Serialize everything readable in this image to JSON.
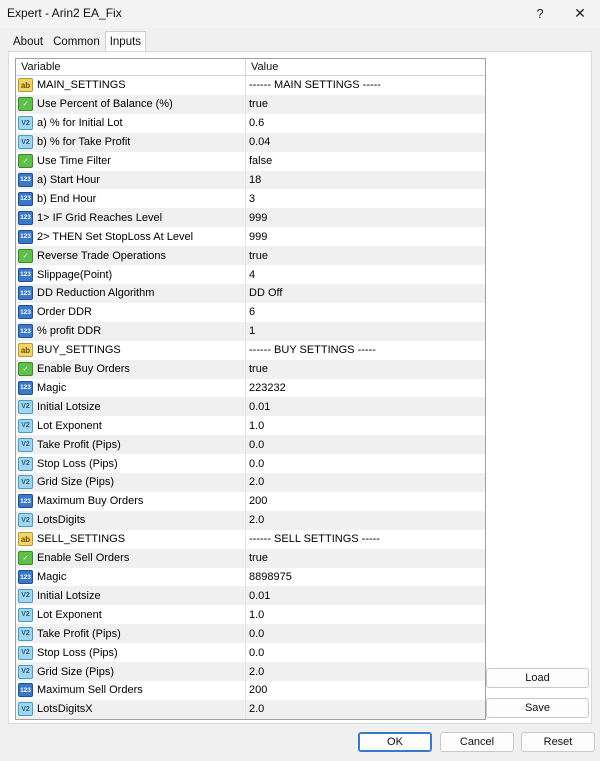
{
  "window": {
    "title": "Expert - Arin2 EA_Fix",
    "help_glyph": "?",
    "close_glyph": "✕"
  },
  "tabs": [
    {
      "label": "About"
    },
    {
      "label": "Common"
    },
    {
      "label": "Inputs"
    }
  ],
  "grid": {
    "headers": {
      "variable": "Variable",
      "value": "Value"
    },
    "rows": [
      {
        "type": "ab",
        "icon_text": "ab",
        "name": "MAIN_SETTINGS",
        "value": "------ MAIN SETTINGS -----"
      },
      {
        "type": "bool",
        "icon_text": "✓",
        "name": "Use Percent of Balance (%)",
        "value": "true"
      },
      {
        "type": "dbl",
        "icon_text": "V2",
        "name": "a) % for Initial Lot",
        "value": "0.6"
      },
      {
        "type": "dbl",
        "icon_text": "V2",
        "name": "b) % for Take Profit",
        "value": "0.04"
      },
      {
        "type": "bool",
        "icon_text": "✓",
        "name": "Use Time Filter",
        "value": "false"
      },
      {
        "type": "int",
        "icon_text": "123",
        "name": "a) Start Hour",
        "value": "18"
      },
      {
        "type": "int",
        "icon_text": "123",
        "name": "b) End Hour",
        "value": "3"
      },
      {
        "type": "int",
        "icon_text": "123",
        "name": "1> IF Grid Reaches Level",
        "value": "999"
      },
      {
        "type": "int",
        "icon_text": "123",
        "name": "2> THEN Set StopLoss At Level",
        "value": "999"
      },
      {
        "type": "bool",
        "icon_text": "✓",
        "name": "Reverse Trade Operations",
        "value": "true"
      },
      {
        "type": "int",
        "icon_text": "123",
        "name": "Slippage(Point)",
        "value": "4"
      },
      {
        "type": "enum",
        "icon_text": "123",
        "name": "DD Reduction Algorithm",
        "value": "DD Off"
      },
      {
        "type": "int",
        "icon_text": "123",
        "name": "Order DDR",
        "value": "6"
      },
      {
        "type": "int",
        "icon_text": "123",
        "name": "% profit DDR",
        "value": "1"
      },
      {
        "type": "ab",
        "icon_text": "ab",
        "name": "BUY_SETTINGS",
        "value": "------ BUY SETTINGS -----"
      },
      {
        "type": "bool",
        "icon_text": "✓",
        "name": "Enable Buy Orders",
        "value": "true"
      },
      {
        "type": "int",
        "icon_text": "123",
        "name": "Magic",
        "value": "223232"
      },
      {
        "type": "dbl",
        "icon_text": "V2",
        "name": "Initial Lotsize",
        "value": "0.01"
      },
      {
        "type": "dbl",
        "icon_text": "V2",
        "name": "Lot Exponent",
        "value": "1.0"
      },
      {
        "type": "dbl",
        "icon_text": "V2",
        "name": "Take Profit (Pips)",
        "value": "0.0"
      },
      {
        "type": "dbl",
        "icon_text": "V2",
        "name": "Stop Loss (Pips)",
        "value": "0.0"
      },
      {
        "type": "dbl",
        "icon_text": "V2",
        "name": "Grid Size (Pips)",
        "value": "2.0"
      },
      {
        "type": "int",
        "icon_text": "123",
        "name": "Maximum Buy Orders",
        "value": "200"
      },
      {
        "type": "dbl",
        "icon_text": "V2",
        "name": "LotsDigits",
        "value": "2.0"
      },
      {
        "type": "ab",
        "icon_text": "ab",
        "name": "SELL_SETTINGS",
        "value": "------ SELL SETTINGS -----"
      },
      {
        "type": "bool",
        "icon_text": "✓",
        "name": "Enable Sell Orders",
        "value": "true"
      },
      {
        "type": "int",
        "icon_text": "123",
        "name": "Magic",
        "value": "8898975"
      },
      {
        "type": "dbl",
        "icon_text": "V2",
        "name": "Initial Lotsize",
        "value": "0.01"
      },
      {
        "type": "dbl",
        "icon_text": "V2",
        "name": "Lot Exponent",
        "value": "1.0"
      },
      {
        "type": "dbl",
        "icon_text": "V2",
        "name": "Take Profit (Pips)",
        "value": "0.0"
      },
      {
        "type": "dbl",
        "icon_text": "V2",
        "name": "Stop Loss (Pips)",
        "value": "0.0"
      },
      {
        "type": "dbl",
        "icon_text": "V2",
        "name": "Grid Size (Pips)",
        "value": "2.0"
      },
      {
        "type": "int",
        "icon_text": "123",
        "name": "Maximum Sell Orders",
        "value": "200"
      },
      {
        "type": "dbl",
        "icon_text": "V2",
        "name": "LotsDigitsX",
        "value": "2.0"
      }
    ]
  },
  "side_buttons": {
    "load": "Load",
    "save": "Save"
  },
  "footer": {
    "ok": "OK",
    "cancel": "Cancel",
    "reset": "Reset"
  }
}
